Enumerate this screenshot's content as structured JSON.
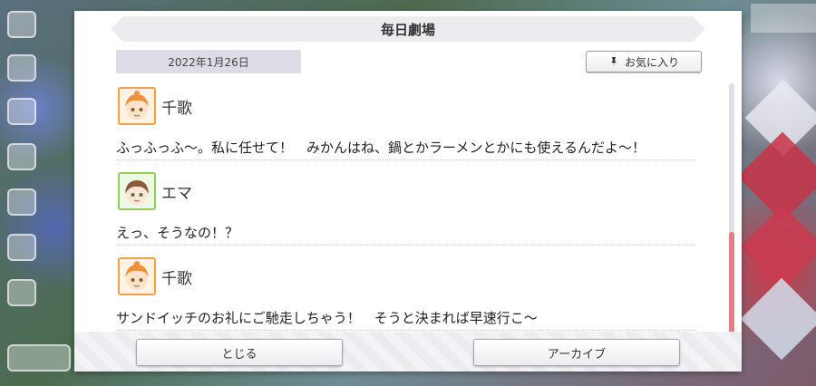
{
  "dialog": {
    "title": "毎日劇場",
    "date": "2022年1月26日",
    "favorite_label": "お気に入り"
  },
  "entries": [
    {
      "speaker": "千歌",
      "avatar": "chika-avatar",
      "text": "ふっふっふ〜。私に任せて！　みかんはね、鍋とかラーメンとかにも使えるんだよ〜！"
    },
    {
      "speaker": "エマ",
      "avatar": "emma-avatar",
      "text": "えっ、そうなの！？"
    },
    {
      "speaker": "千歌",
      "avatar": "chika-avatar",
      "text": "サンドイッチのお礼にご馳走しちゃう！　そうと決まれば早速行こ〜"
    }
  ],
  "buttons": {
    "close_label": "とじる",
    "archive_label": "アーカイブ"
  },
  "colors": {
    "accent_scroll": "#e27d8a",
    "chika_frame": "#f2a04a",
    "emma_frame": "#8ccf5c"
  }
}
